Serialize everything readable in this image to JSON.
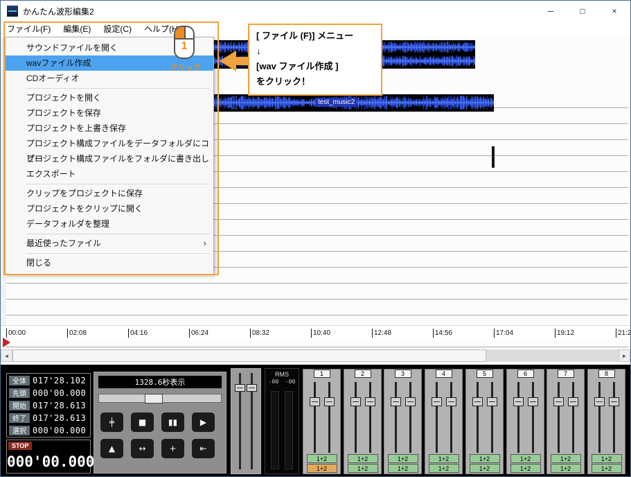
{
  "window": {
    "title": "かんたん波形編集2",
    "minimize": "─",
    "maximize": "□",
    "close": "×"
  },
  "menubar": {
    "items": [
      {
        "label": "ファイル(F)"
      },
      {
        "label": "編集(E)"
      },
      {
        "label": "設定(C)"
      },
      {
        "label": "ヘルプ(H)"
      }
    ]
  },
  "file_menu": {
    "items": [
      {
        "type": "item",
        "label": "サウンドファイルを開く"
      },
      {
        "type": "item",
        "label": "wavファイル作成",
        "highlighted": true
      },
      {
        "type": "item",
        "label": "CDオーディオ"
      },
      {
        "type": "separator"
      },
      {
        "type": "item",
        "label": "プロジェクトを開く"
      },
      {
        "type": "item",
        "label": "プロジェクトを保存"
      },
      {
        "type": "item",
        "label": "プロジェクトを上書き保存"
      },
      {
        "type": "item",
        "label": "プロジェクト構成ファイルをデータフォルダにコピー"
      },
      {
        "type": "item",
        "label": "プロジェクト構成ファイルをフォルダに書き出し"
      },
      {
        "type": "item",
        "label": "エクスポート"
      },
      {
        "type": "separator"
      },
      {
        "type": "item",
        "label": "クリップをプロジェクトに保存"
      },
      {
        "type": "item",
        "label": "プロジェクトをクリップに開く"
      },
      {
        "type": "item",
        "label": "データフォルダを整理"
      },
      {
        "type": "separator"
      },
      {
        "type": "item",
        "label": "最近使ったファイル",
        "submenu": true,
        "submenu_arrow": "›"
      },
      {
        "type": "separator"
      },
      {
        "type": "item",
        "label": "閉じる"
      }
    ]
  },
  "callout": {
    "lines": [
      "[ ファイル (F)] メニュー",
      "↓",
      "[wav ファイル作成 ]",
      "をクリック！"
    ],
    "accent_color": "#f0a23c"
  },
  "mouse_hint": {
    "number": "1",
    "label": "クリック",
    "accent_color": "#f08c1e"
  },
  "tracks": {
    "clip2_label": "test_music2",
    "wave_color": "#2444cc",
    "wave_bright": "#4f78ff",
    "wave_center": "#6f95ff",
    "bg": "#000000"
  },
  "timeline": {
    "labels": [
      "00:00",
      "02:08",
      "04:16",
      "06:24",
      "08:32",
      "10:40",
      "12:48",
      "14:56",
      "17:04",
      "19:12",
      "21:20"
    ]
  },
  "scrollbar": {
    "left_arrow": "◄",
    "right_arrow": "►"
  },
  "time_panel": {
    "rows": [
      {
        "label": "全体",
        "value": "017'28.102"
      },
      {
        "label": "先頭",
        "value": "000'00.000"
      },
      {
        "label": "開始",
        "value": "017'28.613"
      },
      {
        "label": "終了",
        "value": "017'28.613"
      },
      {
        "label": "選択",
        "value": "000'00.000"
      }
    ]
  },
  "stop_panel": {
    "status": "STOP",
    "time": "000'00.000"
  },
  "transport": {
    "display": "1328.6秒表示",
    "row1": [
      {
        "name": "fader-button",
        "glyph": "╪"
      },
      {
        "name": "stop-button",
        "glyph": "■"
      },
      {
        "name": "pause-button",
        "glyph": "▮▮"
      },
      {
        "name": "play-button",
        "glyph": "▶"
      }
    ],
    "row2": [
      {
        "name": "eject-button",
        "glyph": "▲"
      },
      {
        "name": "loop-button",
        "glyph": "↔"
      },
      {
        "name": "add-button",
        "glyph": "+"
      },
      {
        "name": "to-start-button",
        "glyph": "⇤"
      }
    ]
  },
  "meter": {
    "label": "RMS",
    "values": "-00  -00"
  },
  "mixer": {
    "channels": [
      {
        "num": "1",
        "buttons": [
          {
            "label": "1+2",
            "color": "#97cc97"
          },
          {
            "label": "1+2",
            "color": "#e2a95e"
          }
        ]
      },
      {
        "num": "2",
        "buttons": [
          {
            "label": "1+2",
            "color": "#97cc97"
          },
          {
            "label": "1+2",
            "color": "#97cc97"
          }
        ]
      },
      {
        "num": "3",
        "buttons": [
          {
            "label": "1+2",
            "color": "#97cc97"
          },
          {
            "label": "1+2",
            "color": "#97cc97"
          }
        ]
      },
      {
        "num": "4",
        "buttons": [
          {
            "label": "1+2",
            "color": "#97cc97"
          },
          {
            "label": "1+2",
            "color": "#97cc97"
          }
        ]
      },
      {
        "num": "5",
        "buttons": [
          {
            "label": "1+2",
            "color": "#97cc97"
          },
          {
            "label": "1+2",
            "color": "#97cc97"
          }
        ]
      },
      {
        "num": "6",
        "buttons": [
          {
            "label": "1+2",
            "color": "#97cc97"
          },
          {
            "label": "1+2",
            "color": "#97cc97"
          }
        ]
      },
      {
        "num": "7",
        "buttons": [
          {
            "label": "1+2",
            "color": "#97cc97"
          },
          {
            "label": "1+2",
            "color": "#97cc97"
          }
        ]
      },
      {
        "num": "8",
        "buttons": [
          {
            "label": "1+2",
            "color": "#97cc97"
          },
          {
            "label": "1+2",
            "color": "#97cc97"
          }
        ]
      }
    ]
  }
}
